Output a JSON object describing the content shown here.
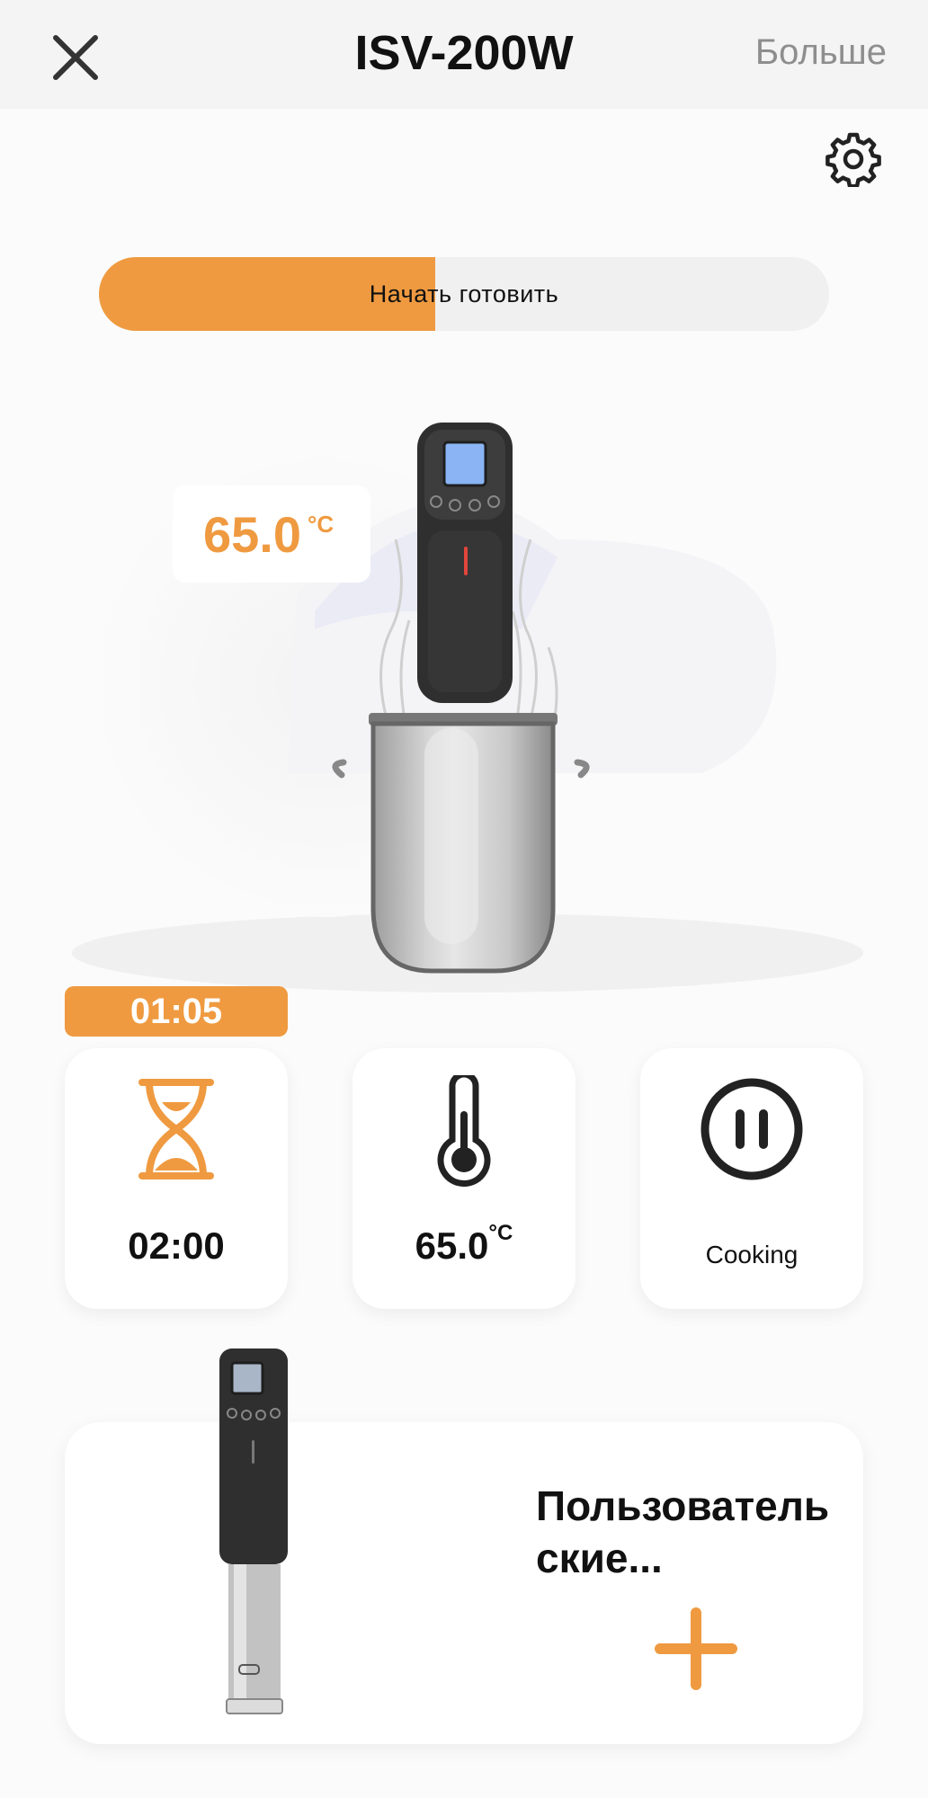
{
  "header": {
    "title": "ISV-200W",
    "more_label": "Больше",
    "close_icon": "close-icon"
  },
  "settings_icon": "gear-icon",
  "start_cooking": {
    "label": "Начать готовить",
    "progress": 0.46,
    "color": "#ef9a40"
  },
  "scene": {
    "current_temp": "65.0",
    "temp_unit": "°C"
  },
  "timer": {
    "elapsed": "01:05"
  },
  "tiles": {
    "time": {
      "icon": "hourglass-icon",
      "value": "02:00"
    },
    "temperature": {
      "icon": "thermometer-icon",
      "value": "65.0",
      "unit": "°C"
    },
    "status": {
      "icon": "pause-icon",
      "label": "Cooking"
    }
  },
  "custom": {
    "title_line1": "Пользователь",
    "title_line2": "ские...",
    "add_icon": "plus-icon"
  },
  "colors": {
    "accent": "#ef9a40",
    "header_bg": "#f4f4f4",
    "page_bg": "#fbfbfb"
  }
}
